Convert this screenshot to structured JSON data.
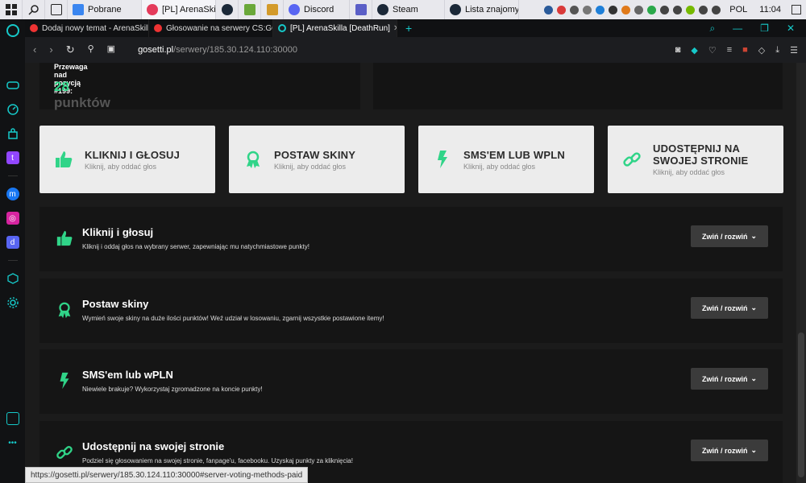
{
  "taskbar": {
    "items": [
      {
        "label": "",
        "icon": "windows-start-icon"
      },
      {
        "label": "",
        "icon": "search-icon"
      },
      {
        "label": "",
        "icon": "task-view-icon"
      },
      {
        "label": "Pobrane",
        "icon": "download-folder-icon"
      },
      {
        "label": "[PL] ArenaSkil...",
        "icon": "opera-gx-icon"
      },
      {
        "label": "",
        "icon": "steam-icon"
      },
      {
        "label": "",
        "icon": "minecraft-icon"
      },
      {
        "label": "",
        "icon": "app-icon"
      },
      {
        "label": "Discord",
        "icon": "discord-icon"
      },
      {
        "label": "",
        "icon": "teams-icon"
      },
      {
        "label": "Steam",
        "icon": "steam-icon"
      },
      {
        "label": "Lista znajomy...",
        "icon": "steam-friends-icon"
      }
    ],
    "lang": "POL",
    "time": "11:04"
  },
  "tabs": [
    {
      "label": "Dodaj nowy temat - ArenaSkilla",
      "active": false
    },
    {
      "label": "Głosowanie na serwery CS:GO",
      "active": false
    },
    {
      "label": "[PL] ArenaSkilla [DeathRun]",
      "active": true
    }
  ],
  "address": {
    "host": "gosetti.pl",
    "path": "/serwery/185.30.124.110:30000"
  },
  "advantage": {
    "label": "Przewaga nad pozycją #199:",
    "value": "28",
    "unit": "punktów"
  },
  "cards": [
    {
      "title": "KLIKNIJ I GŁOSUJ",
      "sub": "Kliknij, aby oddać głos",
      "icon": "thumbs-up-icon"
    },
    {
      "title": "POSTAW SKINY",
      "sub": "Kliknij, aby oddać głos",
      "icon": "award-icon"
    },
    {
      "title": "SMS'EM LUB WPLN",
      "sub": "Kliknij, aby oddać głos",
      "icon": "bolt-icon"
    },
    {
      "title1": "UDOSTĘPNIJ NA",
      "title2": "SWOJEJ STRONIE",
      "sub": "Kliknij, aby oddać głos",
      "icon": "link-icon"
    }
  ],
  "sections": [
    {
      "title": "Kliknij i głosuj",
      "desc": "Kliknij i oddaj głos na wybrany serwer, zapewniając mu natychmiastowe punkty!",
      "button": "Zwiń / rozwiń"
    },
    {
      "title": "Postaw skiny",
      "desc": "Wymień swoje skiny na duże ilości punktów! Weź udział w losowaniu, zgarnij wszystkie postawione itemy!",
      "button": "Zwiń / rozwiń"
    },
    {
      "title": "SMS'em lub wPLN",
      "desc": "Niewiele brakuje? Wykorzystaj zgromadzone na koncie punkty!",
      "button": "Zwiń / rozwiń"
    },
    {
      "title": "Udostępnij na swojej stronie",
      "desc": "Podziel się głosowaniem na swojej stronie, fanpage'u, facebooku. Uzyskaj punkty za kliknięcia!",
      "button": "Zwiń / rozwiń"
    }
  ],
  "status_url": "https://gosetti.pl/serwery/185.30.124.110:30000#server-voting-methods-paid",
  "colors": {
    "accent": "#30d488",
    "sidebar_accent": "#16c9c9"
  }
}
